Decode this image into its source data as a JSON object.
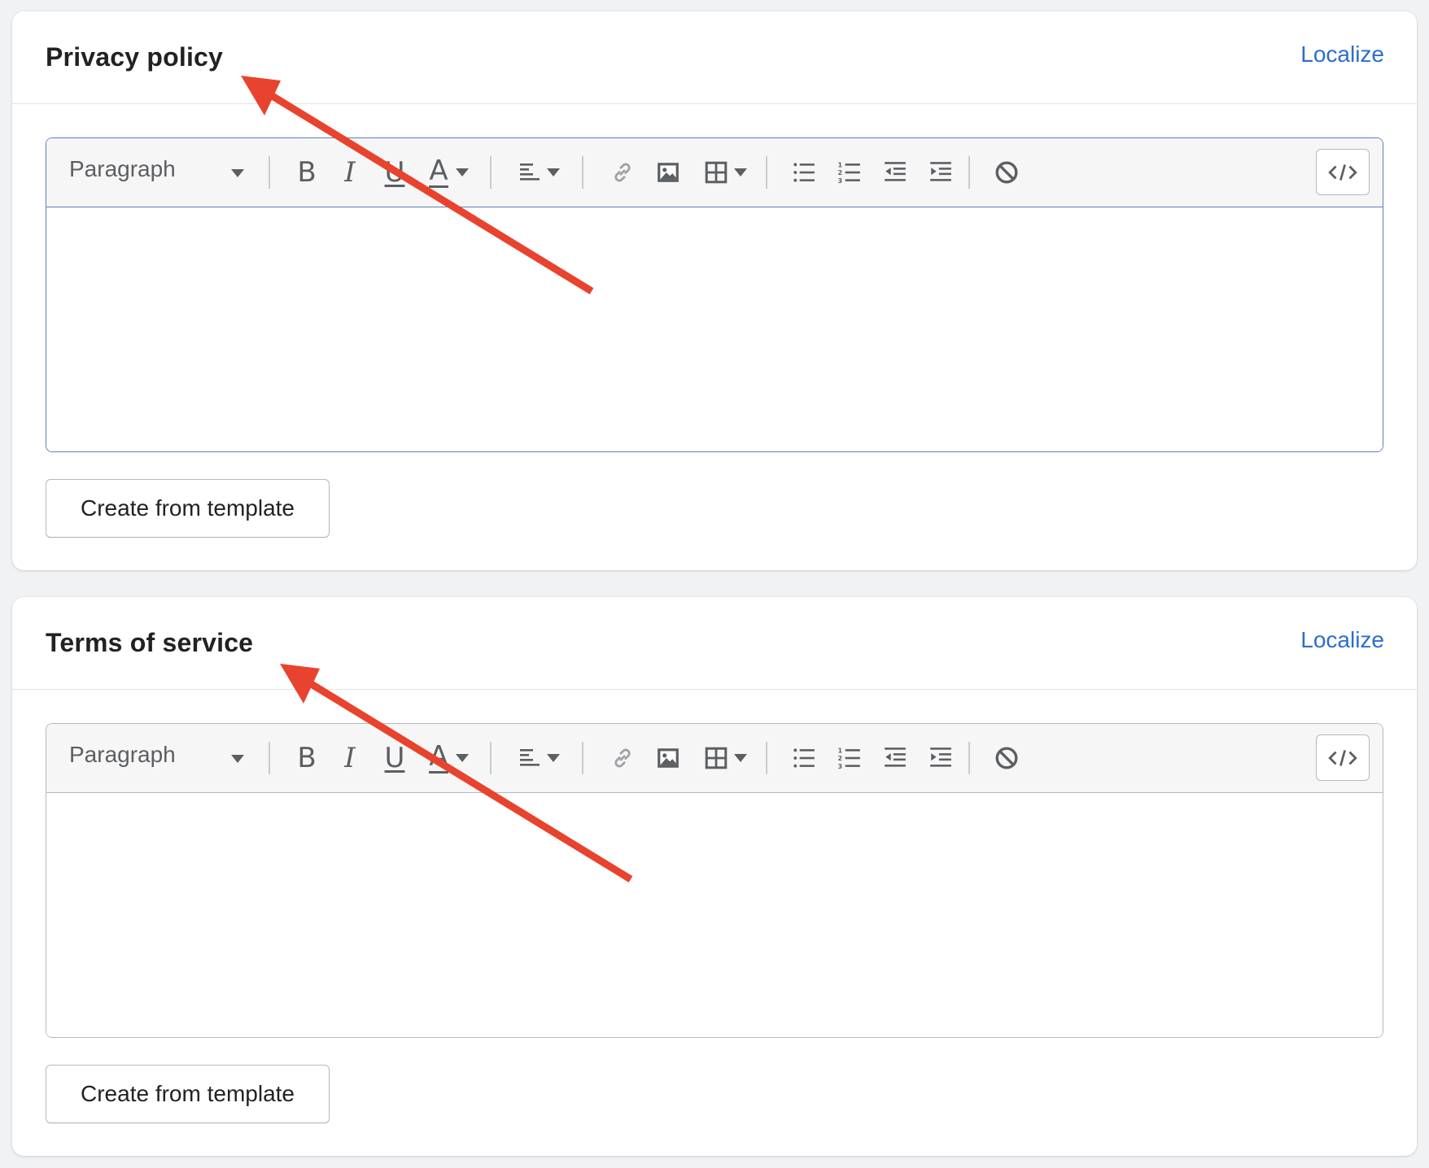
{
  "colors": {
    "page_bg": "#f1f2f4",
    "card_bg": "#ffffff",
    "link": "#2c6ecb",
    "icon": "#5c5f62",
    "focus_border": "#5c7fbd",
    "annotation_arrow": "#e8432e"
  },
  "sections": [
    {
      "title": "Privacy policy",
      "localize_label": "Localize",
      "format_label": "Paragraph",
      "bold_label": "B",
      "italic_label": "I",
      "underline_label": "U",
      "text_color_label": "A",
      "template_button_label": "Create from template",
      "focused": true
    },
    {
      "title": "Terms of service",
      "localize_label": "Localize",
      "format_label": "Paragraph",
      "bold_label": "B",
      "italic_label": "I",
      "underline_label": "U",
      "text_color_label": "A",
      "template_button_label": "Create from template",
      "focused": false
    }
  ],
  "toolbar_icons": [
    "caret-down-icon",
    "bold-icon",
    "italic-icon",
    "underline-icon",
    "text-color-icon",
    "align-left-icon",
    "link-icon",
    "image-icon",
    "table-icon",
    "bullet-list-icon",
    "numbered-list-icon",
    "outdent-icon",
    "indent-icon",
    "clear-formatting-icon",
    "code-view-icon"
  ]
}
